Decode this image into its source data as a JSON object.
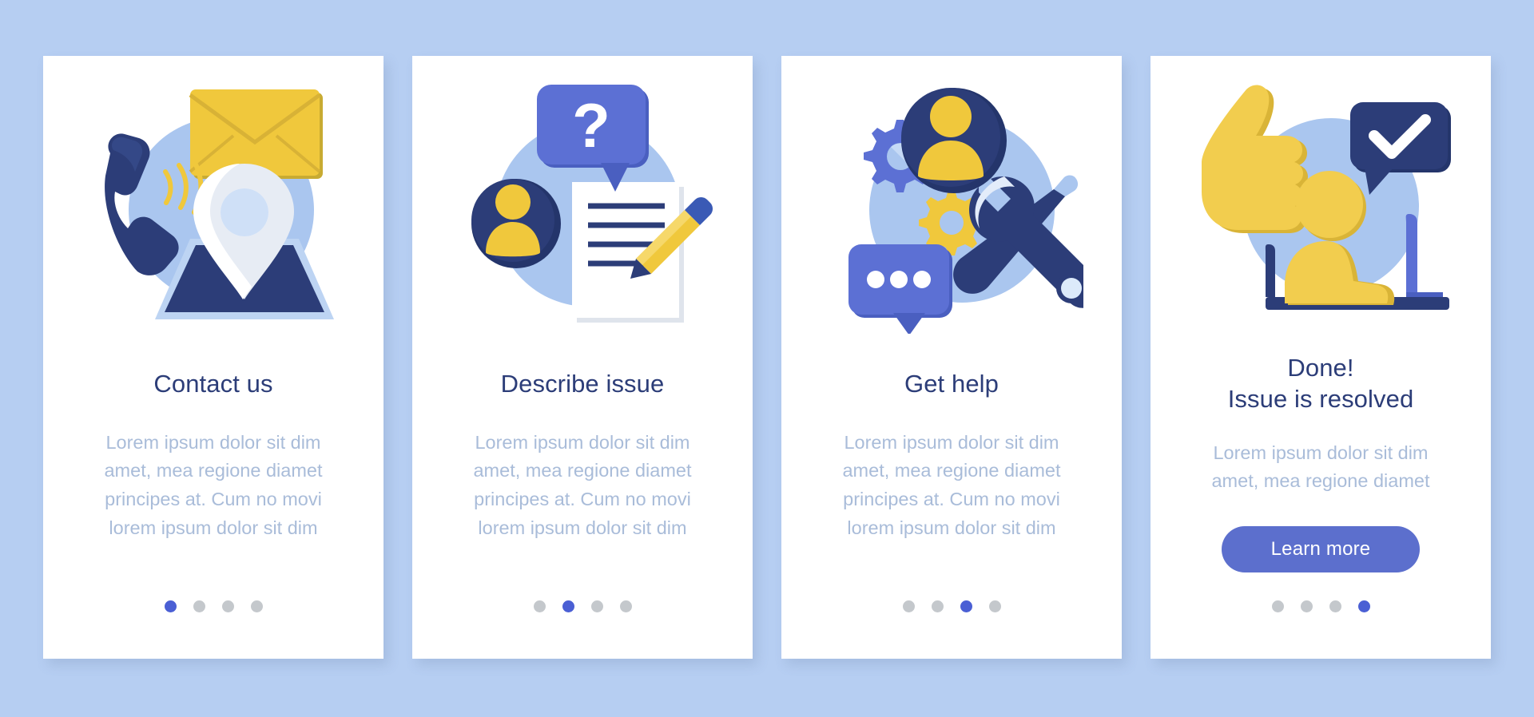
{
  "palette": {
    "background": "#b6cef2",
    "card_background": "#ffffff",
    "title_color": "#2c3d78",
    "body_color": "#a9bcd9",
    "accent_blue": "#5c6fcd",
    "dot_active": "#4a5fd4",
    "dot_inactive": "#c4c8cc",
    "illustration_circle": "#aac6ef",
    "dark_navy": "#2c3d78",
    "yellow": "#f0c83c",
    "periwinkle": "#5c6fcd"
  },
  "screens": [
    {
      "id": "contact-us",
      "illustration_name": "phone-envelope-location-illustration",
      "illustration_elements": [
        "phone-handset-icon",
        "envelope-icon",
        "location-pin-icon",
        "signal-waves-icon"
      ],
      "title": "Contact us",
      "title_line2": "",
      "body": "Lorem ipsum dolor sit dim amet, mea regione diamet principes at. Cum no movi lorem ipsum dolor sit dim",
      "has_button": false,
      "button_label": "",
      "dots": {
        "count": 4,
        "active_index": 0
      }
    },
    {
      "id": "describe-issue",
      "illustration_name": "question-avatar-document-illustration",
      "illustration_elements": [
        "question-bubble-icon",
        "user-avatar-icon",
        "document-icon",
        "pencil-icon"
      ],
      "title": "Describe issue",
      "title_line2": "",
      "body": "Lorem ipsum dolor sit dim amet, mea regione diamet principes at. Cum no movi lorem ipsum dolor sit dim",
      "has_button": false,
      "button_label": "",
      "dots": {
        "count": 4,
        "active_index": 1
      }
    },
    {
      "id": "get-help",
      "illustration_name": "gears-support-tools-illustration",
      "illustration_elements": [
        "gear-icon",
        "user-avatar-icon",
        "wrench-icon",
        "screwdriver-icon",
        "chat-bubble-icon"
      ],
      "title": "Get help",
      "title_line2": "",
      "body": "Lorem ipsum dolor sit dim amet, mea regione diamet principes at. Cum no movi lorem ipsum dolor sit dim",
      "has_button": false,
      "button_label": "",
      "dots": {
        "count": 4,
        "active_index": 2
      }
    },
    {
      "id": "issue-resolved",
      "illustration_name": "thumbs-up-laptop-check-illustration",
      "illustration_elements": [
        "thumbs-up-icon",
        "person-at-laptop-icon",
        "check-bubble-icon"
      ],
      "title": "Done!",
      "title_line2": "Issue is resolved",
      "body": "Lorem ipsum dolor sit dim amet, mea regione diamet",
      "has_button": true,
      "button_label": "Learn more",
      "dots": {
        "count": 4,
        "active_index": 3
      }
    }
  ]
}
